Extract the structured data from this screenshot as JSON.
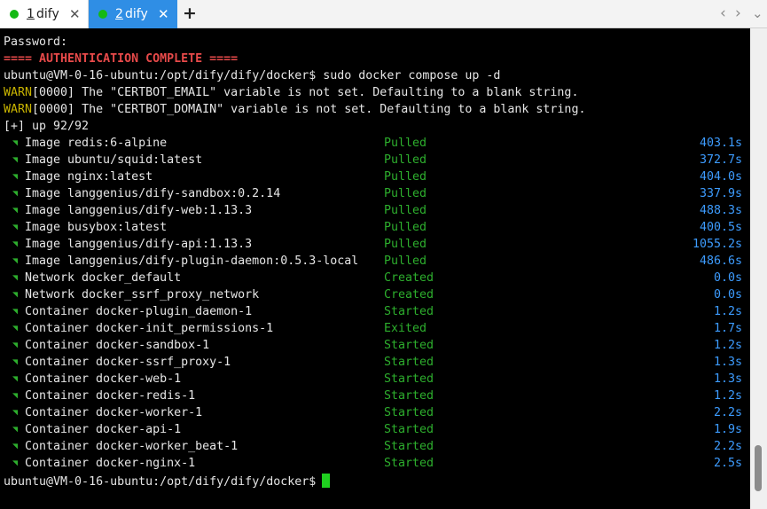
{
  "tabs": [
    {
      "number": "1",
      "label": "dify",
      "active": false,
      "status_color": "#15b915"
    },
    {
      "number": "2",
      "label": "dify",
      "active": true,
      "status_color": "#15b915"
    }
  ],
  "tab_icons": {
    "close": "close-icon",
    "add": "plus-icon",
    "prev": "chevron-left-icon",
    "next": "chevron-right-icon",
    "menu": "chevron-down-icon"
  },
  "glyphs": {
    "close": "✕",
    "add": "+",
    "prev": "‹",
    "next": "›",
    "menu": "⌄",
    "item_tick": "◥"
  },
  "colors": {
    "active_tab": "#2f8ee5",
    "status_green": "#2dae2d",
    "time_blue": "#3d9cff",
    "auth_red": "#e84a4a",
    "warn_yellow": "#c9b400",
    "cursor_green": "#1fd01f"
  },
  "terminal": {
    "password_line": "Password:",
    "auth_line": "==== AUTHENTICATION COMPLETE ====",
    "command_prompt": "ubuntu@VM-0-16-ubuntu:/opt/dify/dify/docker$",
    "command": "sudo docker compose up -d",
    "warnings": [
      {
        "tag": "WARN",
        "text": "[0000] The \"CERTBOT_EMAIL\" variable is not set. Defaulting to a blank string."
      },
      {
        "tag": "WARN",
        "text": "[0000] The \"CERTBOT_DOMAIN\" variable is not set. Defaulting to a blank string."
      }
    ],
    "progress_line": "[+] up 92/92",
    "items": [
      {
        "text": "Image redis:6-alpine",
        "status": "Pulled",
        "time": "403.1s"
      },
      {
        "text": "Image ubuntu/squid:latest",
        "status": "Pulled",
        "time": "372.7s"
      },
      {
        "text": "Image nginx:latest",
        "status": "Pulled",
        "time": "404.0s"
      },
      {
        "text": "Image langgenius/dify-sandbox:0.2.14",
        "status": "Pulled",
        "time": "337.9s"
      },
      {
        "text": "Image langgenius/dify-web:1.13.3",
        "status": "Pulled",
        "time": "488.3s"
      },
      {
        "text": "Image busybox:latest",
        "status": "Pulled",
        "time": "400.5s"
      },
      {
        "text": "Image langgenius/dify-api:1.13.3",
        "status": "Pulled",
        "time": "1055.2s"
      },
      {
        "text": "Image langgenius/dify-plugin-daemon:0.5.3-local",
        "status": "Pulled",
        "time": "486.6s"
      },
      {
        "text": "Network docker_default",
        "status": "Created",
        "time": "0.0s"
      },
      {
        "text": "Network docker_ssrf_proxy_network",
        "status": "Created",
        "time": "0.0s"
      },
      {
        "text": "Container docker-plugin_daemon-1",
        "status": "Started",
        "time": "1.2s"
      },
      {
        "text": "Container docker-init_permissions-1",
        "status": "Exited",
        "time": "1.7s"
      },
      {
        "text": "Container docker-sandbox-1",
        "status": "Started",
        "time": "1.2s"
      },
      {
        "text": "Container docker-ssrf_proxy-1",
        "status": "Started",
        "time": "1.3s"
      },
      {
        "text": "Container docker-web-1",
        "status": "Started",
        "time": "1.3s"
      },
      {
        "text": "Container docker-redis-1",
        "status": "Started",
        "time": "1.2s"
      },
      {
        "text": "Container docker-worker-1",
        "status": "Started",
        "time": "2.2s"
      },
      {
        "text": "Container docker-api-1",
        "status": "Started",
        "time": "1.9s"
      },
      {
        "text": "Container docker-worker_beat-1",
        "status": "Started",
        "time": "2.2s"
      },
      {
        "text": "Container docker-nginx-1",
        "status": "Started",
        "time": "2.5s"
      }
    ],
    "final_prompt": "ubuntu@VM-0-16-ubuntu:/opt/dify/dify/docker$"
  }
}
